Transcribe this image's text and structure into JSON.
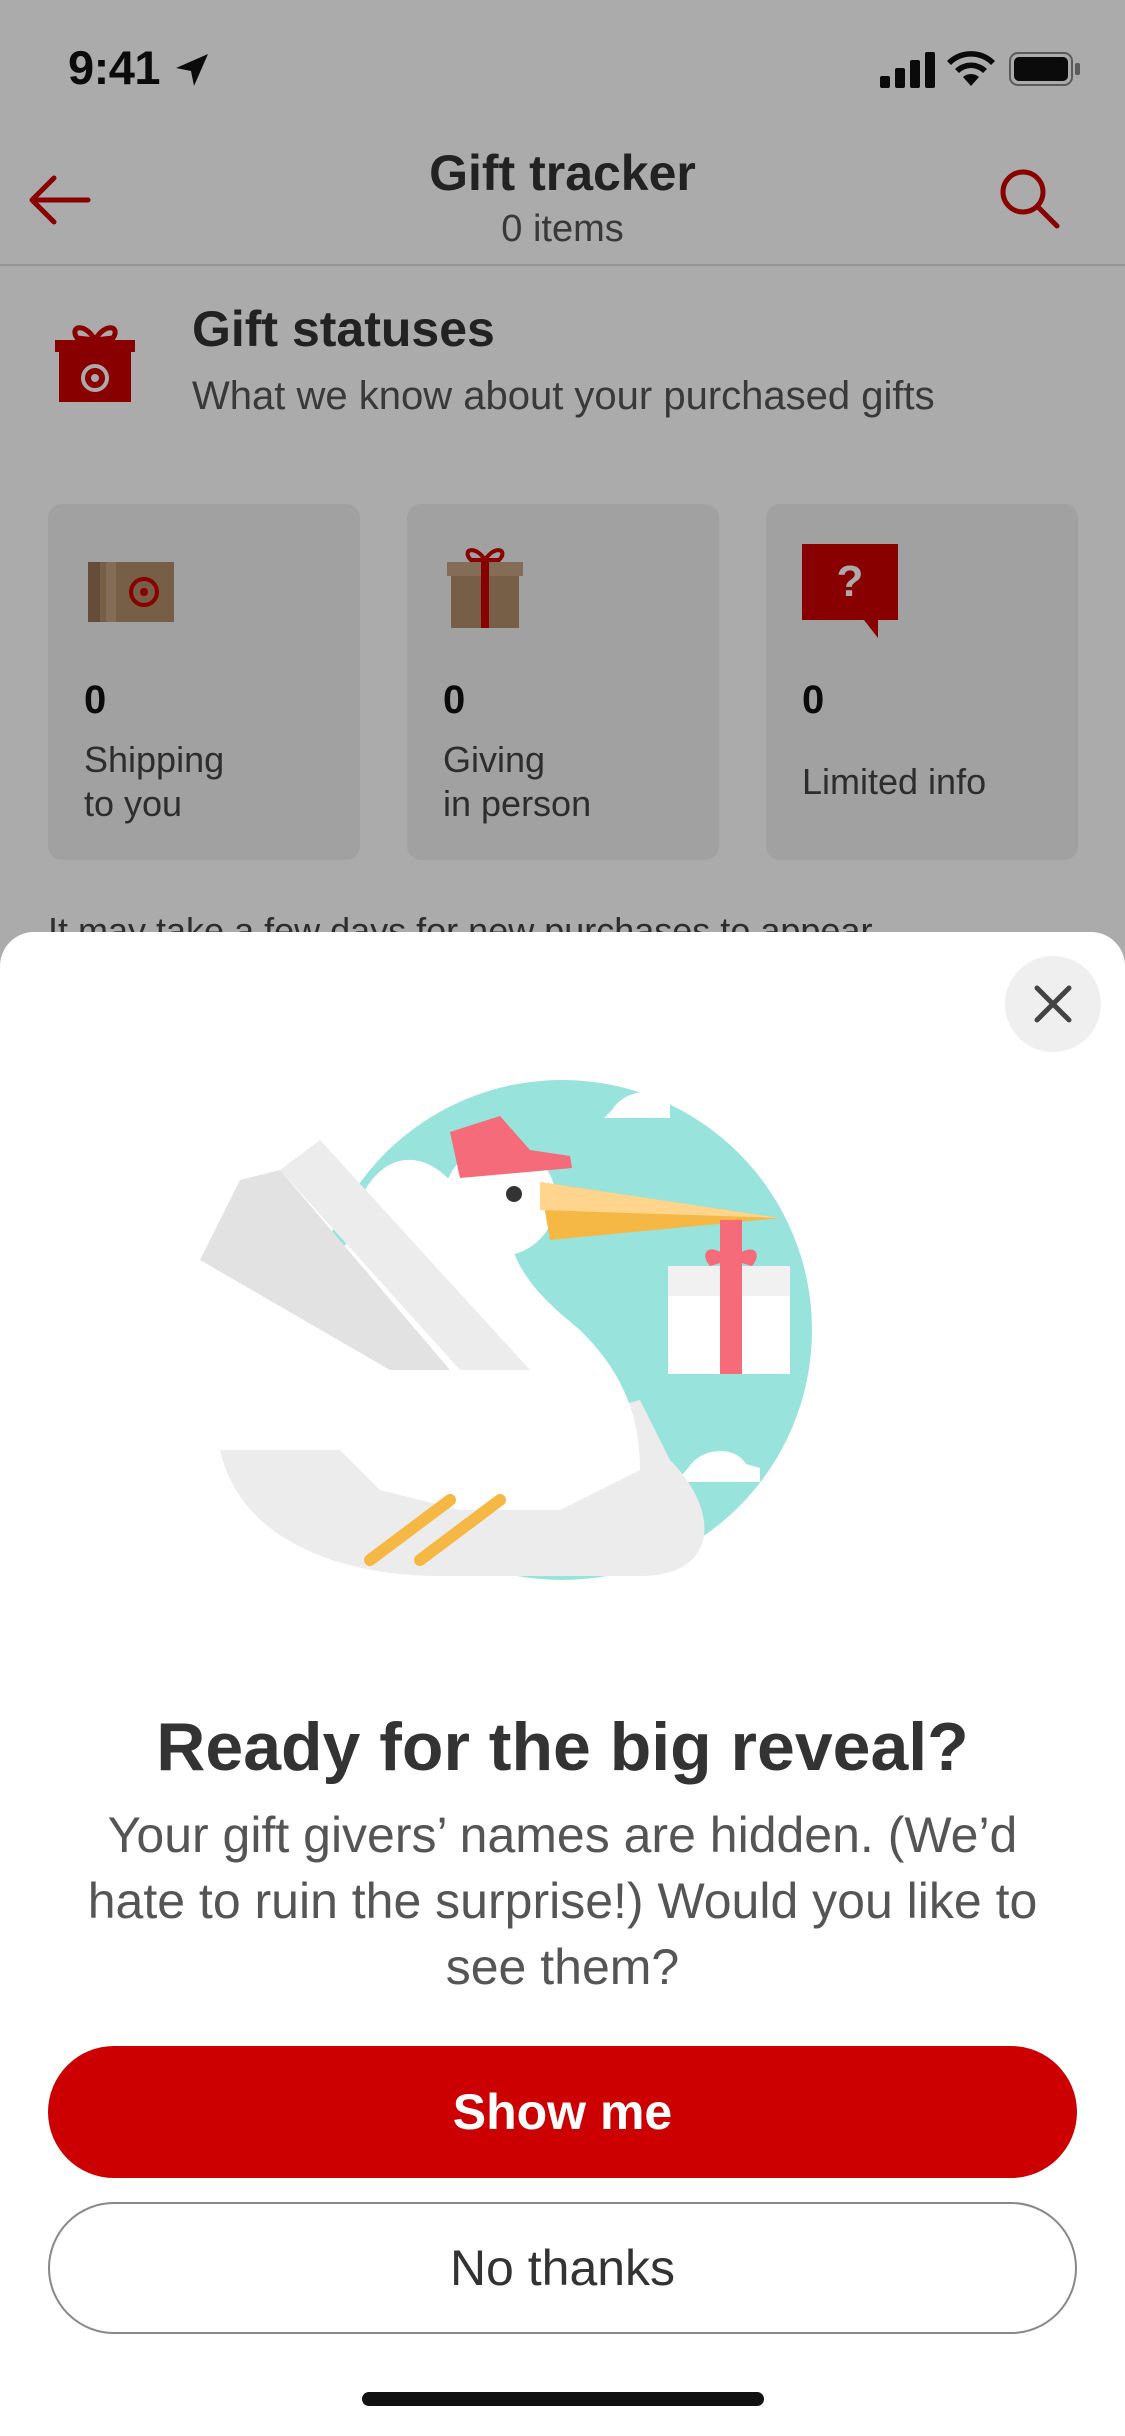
{
  "status_bar": {
    "time": "9:41"
  },
  "header": {
    "title": "Gift tracker",
    "subtitle": "0 items"
  },
  "gift_statuses": {
    "title": "Gift statuses",
    "subtitle": "What we know about your purchased gifts",
    "cards": [
      {
        "count": "0",
        "label": "Shipping\nto you",
        "icon": "package-icon"
      },
      {
        "count": "0",
        "label": "Giving\nin person",
        "icon": "gift-icon"
      },
      {
        "count": "0",
        "label": "Limited info",
        "icon": "question-icon"
      }
    ],
    "note": "It may take a few days for new purchases to appear."
  },
  "modal": {
    "title": "Ready for the big reveal?",
    "body": "Your gift givers’ names are hidden. (We’d hate to ruin the surprise!) Would you like to see them?",
    "primary_label": "Show me",
    "secondary_label": "No thanks"
  },
  "colors": {
    "brand_red": "#cc0000",
    "teal": "#98e3dc",
    "overlay": "rgba(0,0,0,0.33)"
  }
}
